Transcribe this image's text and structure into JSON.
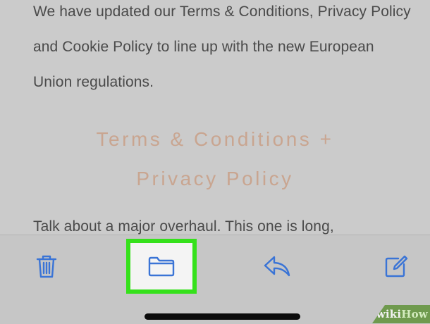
{
  "email": {
    "paragraph_1": "We have updated our Terms & Conditions, Privacy Policy and Cookie Policy to line up with the new European Union regulations.",
    "heading_line_1": "Terms & Conditions +",
    "heading_line_2": "Privacy Policy",
    "paragraph_2": "Talk about a major overhaul. This one is long,"
  },
  "toolbar": {
    "buttons": [
      {
        "icon": "trash-icon"
      },
      {
        "icon": "folder-icon",
        "highlighted": true,
        "highlight_color": "#35e11b"
      },
      {
        "icon": "reply-icon"
      },
      {
        "icon": "compose-icon"
      }
    ],
    "accent_color": "#3a74d6"
  },
  "watermark": {
    "part_a": "wiki",
    "part_b": "How"
  }
}
